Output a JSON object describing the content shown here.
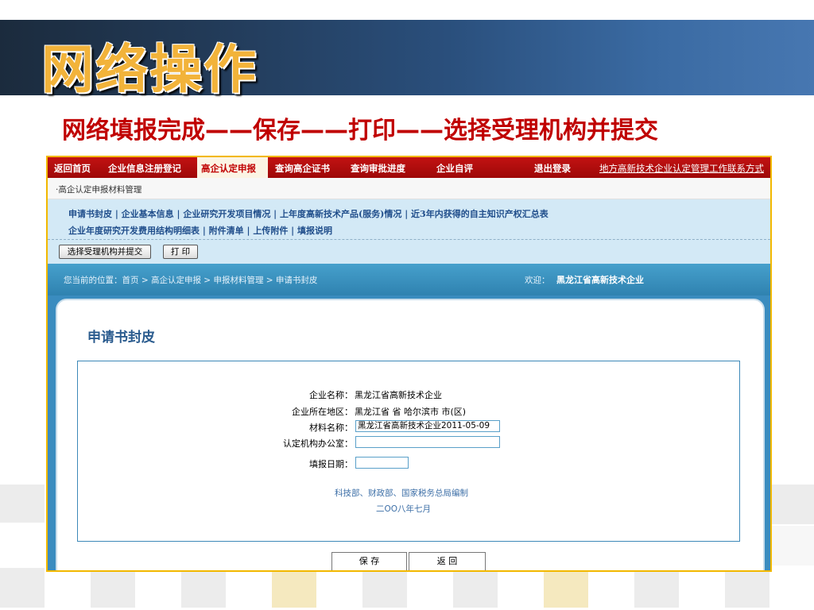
{
  "slide": {
    "title": "网络操作",
    "subtitle": "网络填报完成——保存——打印——选择受理机构并提交"
  },
  "nav": {
    "items": [
      "返回首页",
      "企业信息注册登记",
      "查询高企证书",
      "查询审批进度",
      "企业自评",
      "退出登录"
    ],
    "active": "高企认定申报",
    "right_link": "地方高新技术企业认定管理工作联系方式"
  },
  "breadcrumb_top": "·高企认定申报材料管理",
  "subnav": {
    "row1": "申请书封皮 | 企业基本信息 | 企业研究开发项目情况 | 上年度高新技术产品(服务)情况 | 近3年内获得的自主知识产权汇总表",
    "row2": "企业年度研究开发费用结构明细表 | 附件清单 | 上传附件 | 填报说明"
  },
  "buttons": {
    "select_submit": "选择受理机构并提交",
    "print": "打 印",
    "save": "保 存",
    "back": "返 回"
  },
  "location": {
    "path": "您当前的位置：首页 > 高企认定申报 > 申报材料管理 > 申请书封皮",
    "welcome_label": "欢迎：",
    "company": "黑龙江省高新技术企业"
  },
  "page_title": "申请书封皮",
  "form": {
    "company_name_label": "企业名称：",
    "company_name_value": "黑龙江省高新技术企业",
    "region_label": "企业所在地区：",
    "region_value": "黑龙江省 省 哈尔滨市 市(区)",
    "material_label": "材料名称：",
    "material_value": "黑龙江省高新技术企业2011-05-09",
    "office_label": "认定机构办公室：",
    "office_value": "",
    "date_label": "填报日期：",
    "date_value": ""
  },
  "footer": {
    "compiled_by": "科技部、财政部、国家税务总局编制",
    "date": "二OO八年七月"
  }
}
